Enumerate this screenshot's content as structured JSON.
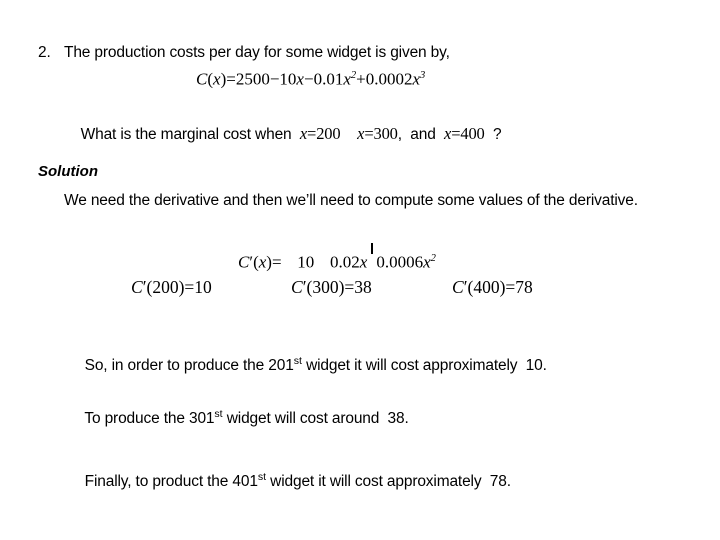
{
  "document": {
    "background_color": "#ffffff",
    "text_color": "#000000"
  },
  "problem": {
    "number": "2.",
    "statement": "The production costs per day for some widget is given by,",
    "cost_equation": {
      "lhs_fn": "C",
      "lhs_var": "x",
      "equals": "=",
      "term_constant": "2500",
      "op1": "−",
      "term_linear_coef": "10",
      "term_linear_var": "x",
      "op2": "−",
      "term_quad_coef": "0.01",
      "term_quad_var": "x",
      "term_quad_exp": "2",
      "op3": "+",
      "term_cubic_coef": "0.0002",
      "term_cubic_var": "x",
      "term_cubic_exp": "3",
      "plain": "C(x) = 2500 - 10x - 0.01x^2 + 0.0002x^3"
    },
    "question_prefix": "What is the marginal cost when",
    "x_value_1": {
      "var": "x",
      "eq": "=",
      "value": "200"
    },
    "x_value_2": {
      "var": "x",
      "eq": "=",
      "value": "300"
    },
    "question_mid": ",  and",
    "x_value_3": {
      "var": "x",
      "eq": "=",
      "value": "400"
    },
    "question_suffix": "?"
  },
  "solution": {
    "heading": "Solution",
    "paragraph": "We need the derivative and then we’ll need to compute some values of the derivative.",
    "derivative_equation": {
      "lhs_fn": "C",
      "prime": "′",
      "lhs_var": "x",
      "equals": "=",
      "term_constant": "10",
      "op1": "−",
      "term_linear_coef": "0.02",
      "term_linear_var": "x",
      "op2": "+",
      "term_quad_coef": "0.0006",
      "term_quad_var": "x",
      "term_quad_exp": "2",
      "plain": "C'(x) = -10 - 0.02x + 0.0006x^2"
    },
    "evaluations": [
      {
        "fn": "C",
        "prime": "′",
        "arg": "200",
        "equals": "=",
        "value": "10",
        "plain": "C'(200) = 10"
      },
      {
        "fn": "C",
        "prime": "′",
        "arg": "300",
        "equals": "=",
        "value": "38",
        "plain": "C'(300) = 38"
      },
      {
        "fn": "C",
        "prime": "′",
        "arg": "400",
        "equals": "=",
        "value": "78",
        "plain": "C'(400) = 78"
      }
    ],
    "conclusions": [
      {
        "lead": "So, in order to produce the ",
        "ordinal_number": "201",
        "ordinal_suffix": "st",
        "tail": " widget it will cost approximately  10.",
        "plain": "So, in order to produce the 201st widget it will cost approximately 10."
      },
      {
        "lead": "To produce the ",
        "ordinal_number": "301",
        "ordinal_suffix": "st",
        "tail": " widget will cost around  38.",
        "plain": "To produce the 301st widget will cost around 38."
      },
      {
        "lead": "Finally, to product the ",
        "ordinal_number": "401",
        "ordinal_suffix": "st",
        "tail": " widget it will cost approximately  78.",
        "plain": "Finally, to product the 401st widget it will cost approximately 78."
      }
    ]
  }
}
